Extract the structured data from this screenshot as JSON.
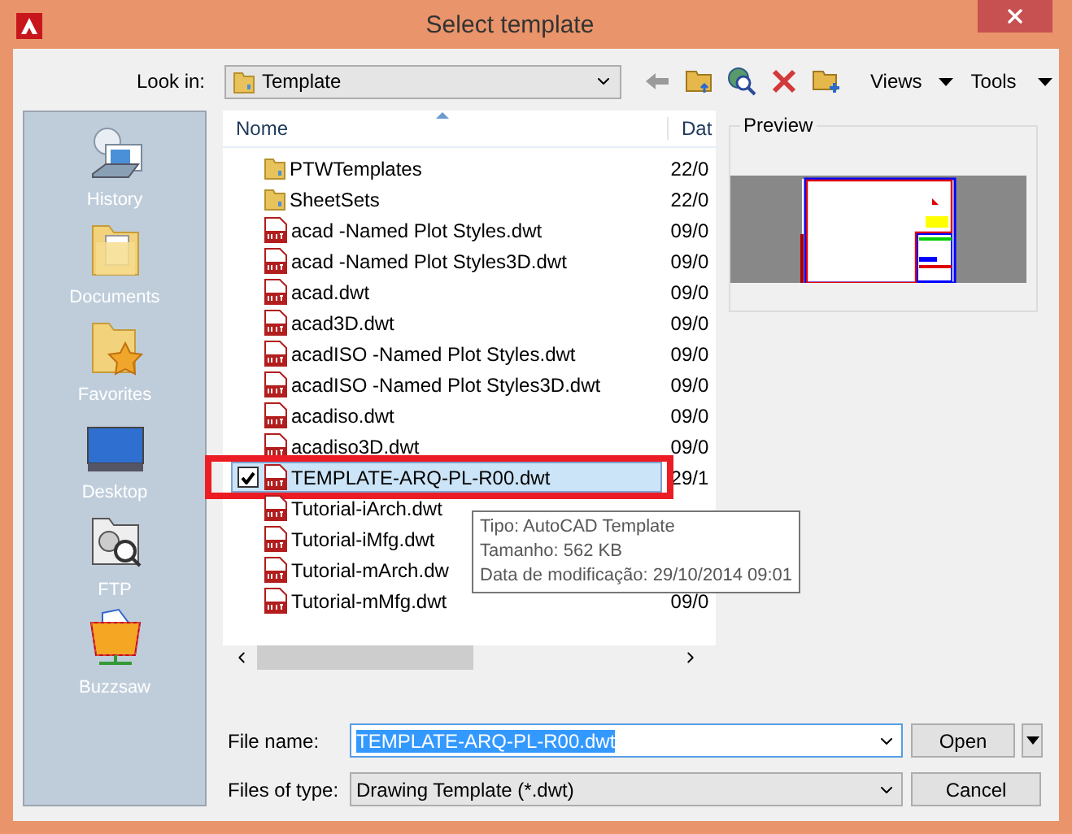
{
  "window": {
    "title": "Select template"
  },
  "toolbar": {
    "look_in_label": "Look in:",
    "look_in_value": "Template",
    "views": "Views",
    "tools": "Tools"
  },
  "places": [
    {
      "label": "History",
      "kind": "history"
    },
    {
      "label": "Documents",
      "kind": "documents"
    },
    {
      "label": "Favorites",
      "kind": "favorites"
    },
    {
      "label": "Desktop",
      "kind": "desktop"
    },
    {
      "label": "FTP",
      "kind": "ftp"
    },
    {
      "label": "Buzzsaw",
      "kind": "buzzsaw"
    }
  ],
  "file_list": {
    "columns": [
      "Nome",
      "Dat"
    ],
    "rows": [
      {
        "name": "PTWTemplates",
        "kind": "folder",
        "date": "22/0",
        "selected": false,
        "checked": false,
        "highlighted": false
      },
      {
        "name": "SheetSets",
        "kind": "folder",
        "date": "22/0",
        "selected": false,
        "checked": false,
        "highlighted": false
      },
      {
        "name": "acad -Named Plot Styles.dwt",
        "kind": "dwt",
        "date": "09/0",
        "selected": false,
        "checked": false,
        "highlighted": false
      },
      {
        "name": "acad -Named Plot Styles3D.dwt",
        "kind": "dwt",
        "date": "09/0",
        "selected": false,
        "checked": false,
        "highlighted": false
      },
      {
        "name": "acad.dwt",
        "kind": "dwt",
        "date": "09/0",
        "selected": false,
        "checked": false,
        "highlighted": false
      },
      {
        "name": "acad3D.dwt",
        "kind": "dwt",
        "date": "09/0",
        "selected": false,
        "checked": false,
        "highlighted": false
      },
      {
        "name": "acadISO -Named Plot Styles.dwt",
        "kind": "dwt",
        "date": "09/0",
        "selected": false,
        "checked": false,
        "highlighted": false
      },
      {
        "name": "acadISO -Named Plot Styles3D.dwt",
        "kind": "dwt",
        "date": "09/0",
        "selected": false,
        "checked": false,
        "highlighted": false
      },
      {
        "name": "acadiso.dwt",
        "kind": "dwt",
        "date": "09/0",
        "selected": false,
        "checked": false,
        "highlighted": false
      },
      {
        "name": "acadiso3D.dwt",
        "kind": "dwt",
        "date": "09/0",
        "selected": false,
        "checked": false,
        "highlighted": false
      },
      {
        "name": "TEMPLATE-ARQ-PL-R00.dwt",
        "kind": "dwt",
        "date": "29/1",
        "selected": true,
        "checked": true,
        "highlighted": true
      },
      {
        "name": "Tutorial-iArch.dwt",
        "kind": "dwt",
        "selected": false,
        "checked": false,
        "highlighted": false
      },
      {
        "name": "Tutorial-iMfg.dwt",
        "kind": "dwt",
        "selected": false,
        "checked": false,
        "highlighted": false
      },
      {
        "name": "Tutorial-mArch.dw",
        "kind": "dwt",
        "selected": false,
        "checked": false,
        "highlighted": false
      },
      {
        "name": "Tutorial-mMfg.dwt",
        "kind": "dwt",
        "date": "09/0",
        "selected": false,
        "checked": false,
        "highlighted": false
      }
    ]
  },
  "tooltip": {
    "lines": [
      "Tipo: AutoCAD Template",
      "Tamanho: 562 KB",
      "Data de modificação: 29/10/2014 09:01"
    ]
  },
  "preview": {
    "title": "Preview"
  },
  "file_name": {
    "label": "File name:",
    "value": "TEMPLATE-ARQ-PL-R00.dwt"
  },
  "files_of_type": {
    "label": "Files of type:",
    "value": "Drawing Template (*.dwt)"
  },
  "buttons": {
    "open": "Open",
    "cancel": "Cancel"
  }
}
